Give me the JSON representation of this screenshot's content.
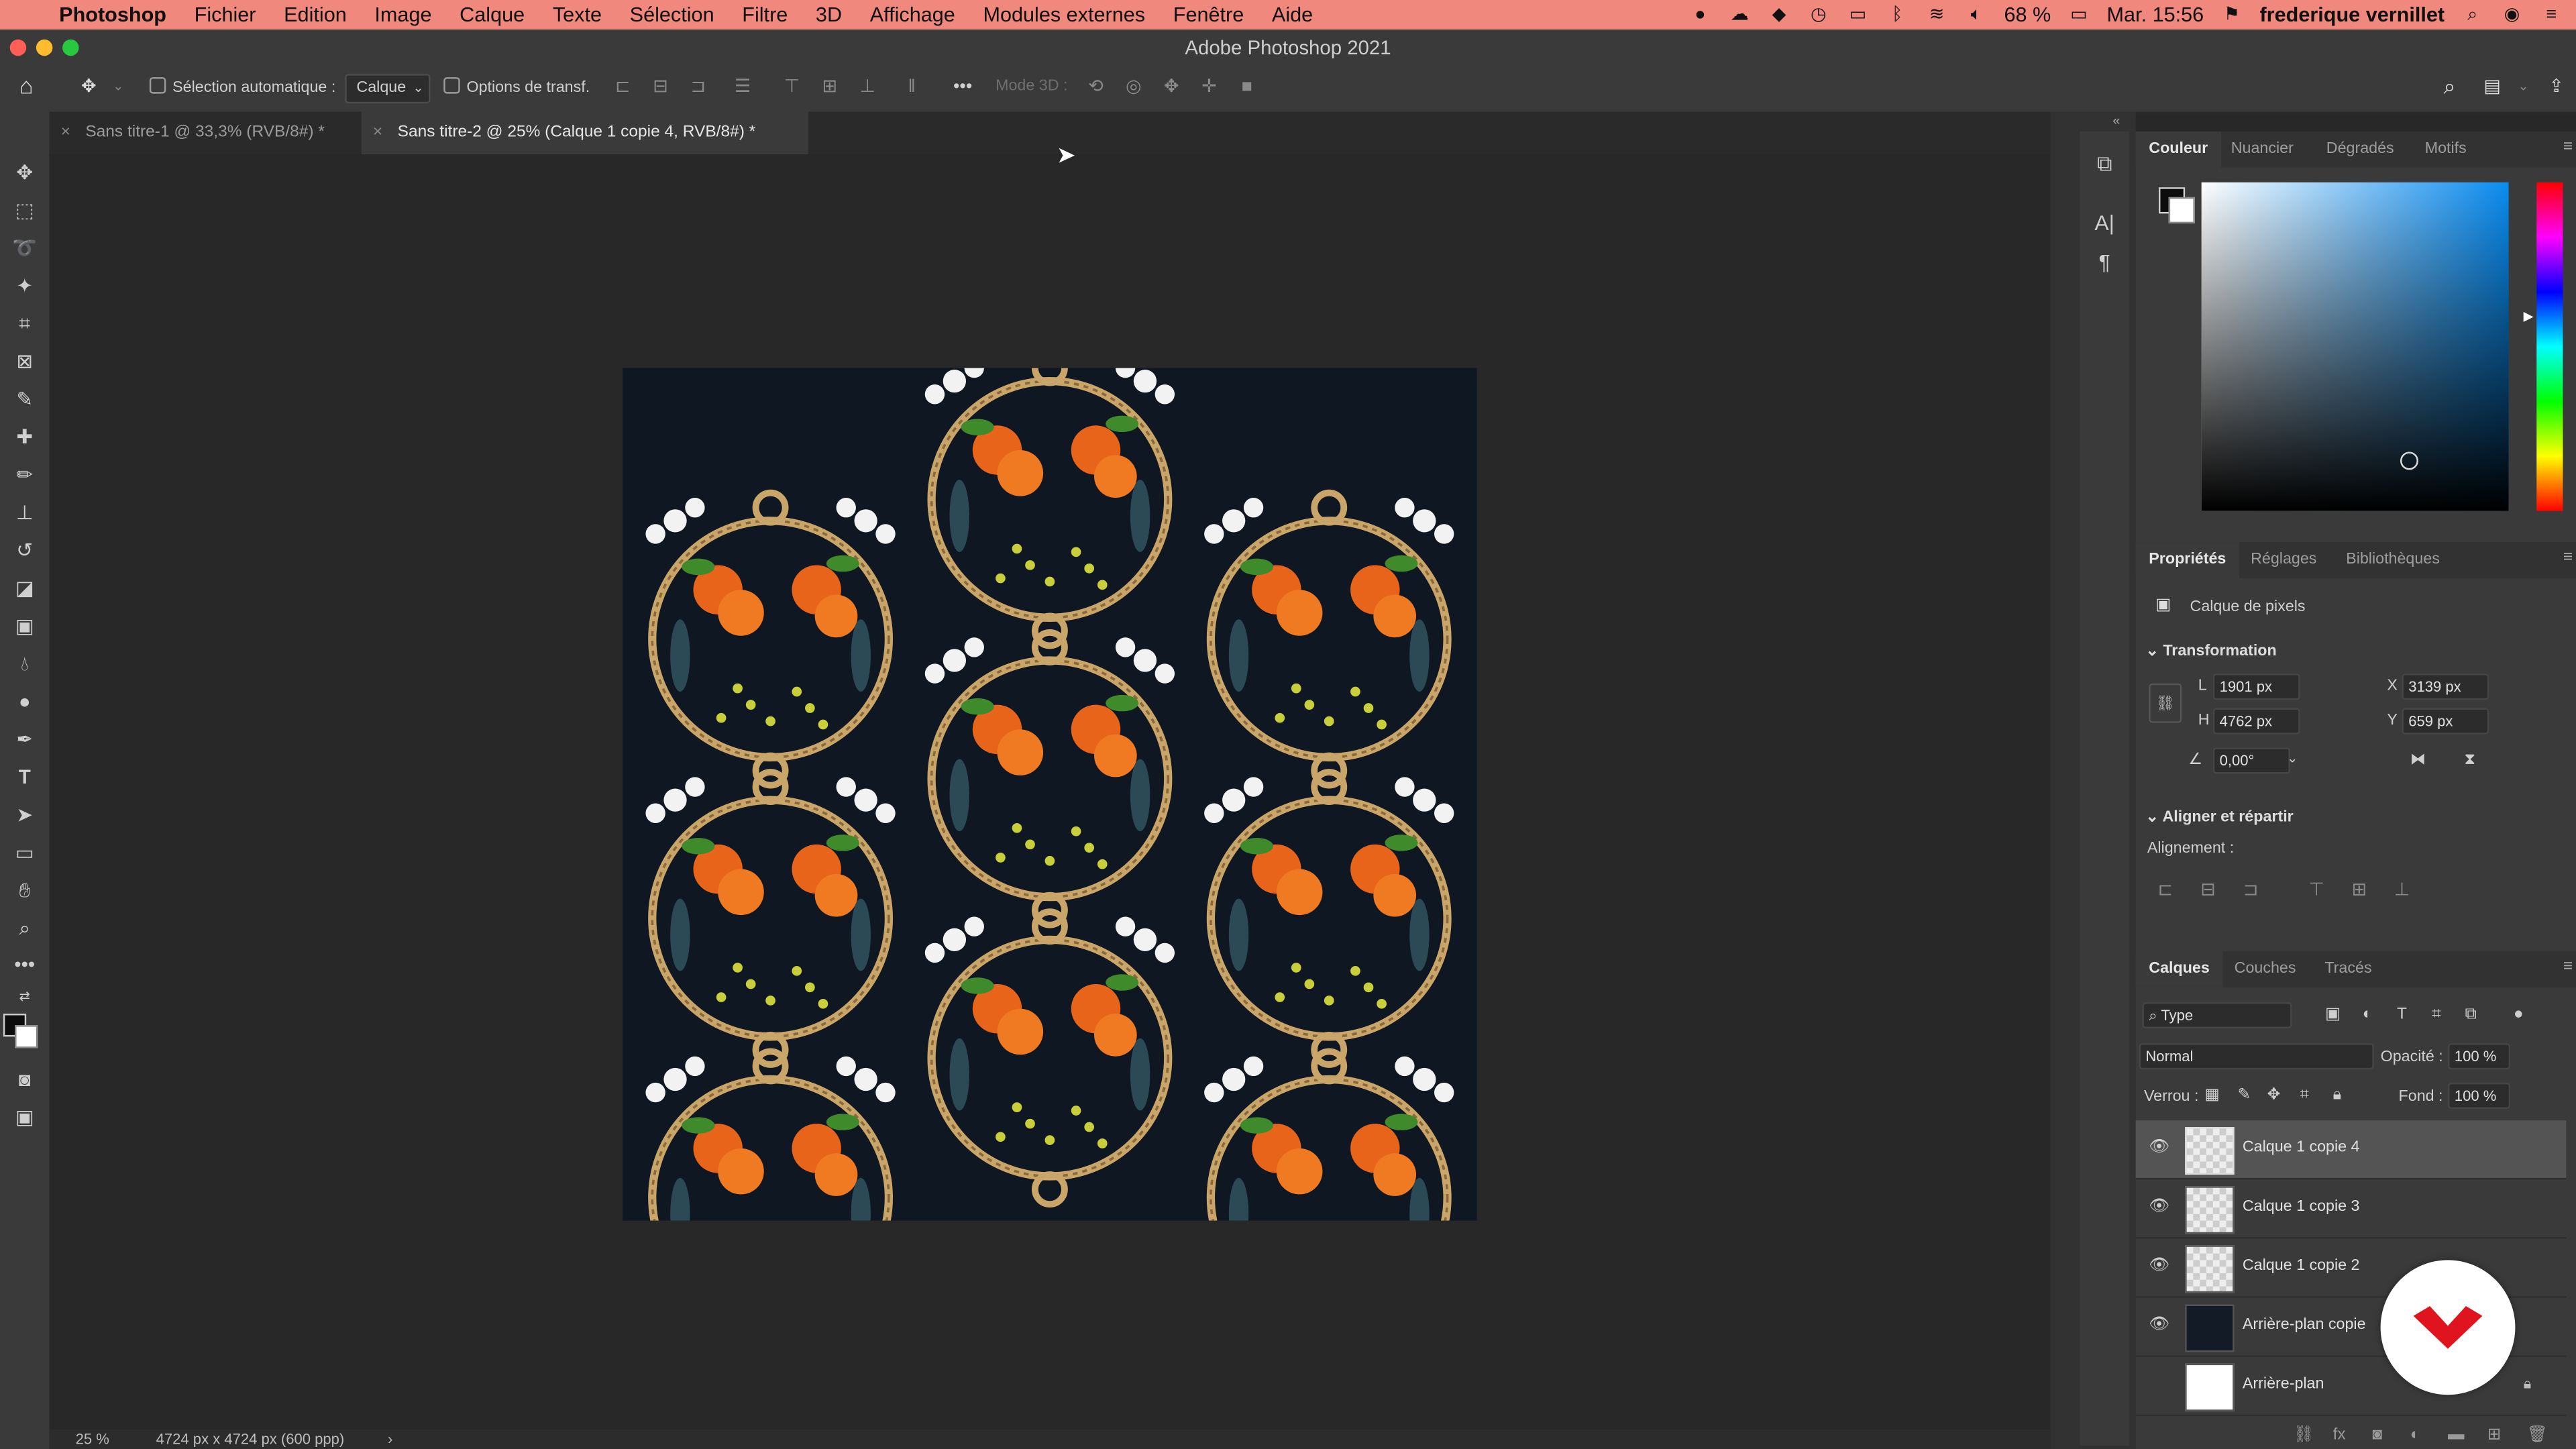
{
  "menubar": {
    "app": "Photoshop",
    "items": [
      "Fichier",
      "Edition",
      "Image",
      "Calque",
      "Texte",
      "Sélection",
      "Filtre",
      "3D",
      "Affichage",
      "Modules externes",
      "Fenêtre",
      "Aide"
    ],
    "battery": "68 %",
    "clock": "Mar. 15:56",
    "user": "frederique vernillet"
  },
  "window": {
    "title": "Adobe Photoshop 2021"
  },
  "options": {
    "auto_select": "Sélection automatique :",
    "layer_select": "Calque",
    "transform_opts": "Options de transf.",
    "mode3d": "Mode 3D :"
  },
  "tabs": [
    {
      "label": "Sans titre-1 @ 33,3% (RVB/8#) *"
    },
    {
      "label": "Sans titre-2 @ 25% (Calque 1 copie 4, RVB/8#) *"
    }
  ],
  "status": {
    "zoom": "25 %",
    "size": "4724 px x 4724 px (600 ppp)",
    "arrow": "›"
  },
  "color_panel": {
    "tabs": [
      "Couleur",
      "Nuancier",
      "Dégradés",
      "Motifs"
    ]
  },
  "properties": {
    "tabs": [
      "Propriétés",
      "Réglages",
      "Bibliothèques"
    ],
    "kind": "Calque de pixels",
    "transform_title": "Transformation",
    "L_label": "L",
    "L": "1901 px",
    "H_label": "H",
    "H": "4762 px",
    "X_label": "X",
    "X": "3139 px",
    "Y_label": "Y",
    "Y": "659 px",
    "angle": "0,00°",
    "align_title": "Aligner et répartir",
    "align_label": "Alignement :"
  },
  "layers": {
    "tabs": [
      "Calques",
      "Couches",
      "Tracés"
    ],
    "filter": "Type",
    "blend": "Normal",
    "opacity_label": "Opacité :",
    "opacity": "100 %",
    "lock_label": "Verrou :",
    "fill_label": "Fond :",
    "fill": "100 %",
    "items": [
      {
        "name": "Calque 1 copie 4"
      },
      {
        "name": "Calque 1 copie 3"
      },
      {
        "name": "Calque 1 copie 2"
      },
      {
        "name": "Arrière-plan copie"
      },
      {
        "name": "Arrière-plan"
      }
    ]
  },
  "colors": {
    "menubar": "#f0887e",
    "pattern_bg": "#0e1722",
    "badge": "#e0141e"
  }
}
